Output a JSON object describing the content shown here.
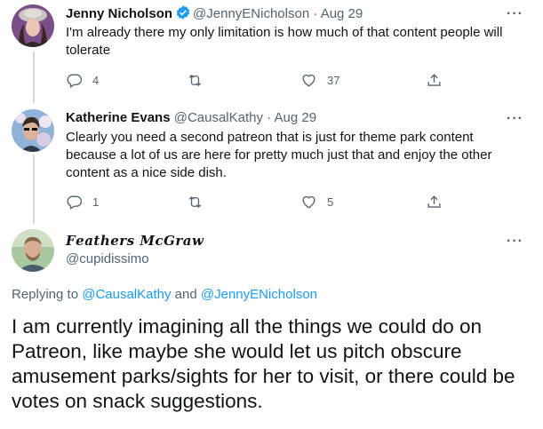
{
  "tweets": [
    {
      "name": "Jenny Nicholson",
      "handle": "@JennyENicholson",
      "dot": "·",
      "date": "Aug 29",
      "more": "···",
      "text": "I'm already there my only limitation is how much of that content people will tolerate",
      "replies": "4",
      "retweets": "",
      "likes": "37",
      "verified": true
    },
    {
      "name": "Katherine Evans",
      "handle": "@CausalKathy",
      "dot": "·",
      "date": "Aug 29",
      "more": "···",
      "text": "Clearly you need a second patreon that is just for theme park content because a lot of us are here for pretty much just that and enjoy the other content as a nice side dish.",
      "replies": "1",
      "retweets": "",
      "likes": "5",
      "verified": false
    }
  ],
  "main": {
    "name": "𝑭𝒆𝒂𝒕𝒉𝒆𝒓𝒔 𝑴𝒄𝑮𝒓𝒂𝒘",
    "handle": "@cupidissimo",
    "more": "···",
    "replying_prefix": "Replying to ",
    "replying_to_1": "@CausalKathy",
    "replying_and": " and ",
    "replying_to_2": "@JennyENicholson",
    "text": "I am currently imagining all the things we could do on Patreon, like maybe she would let us pitch obscure amusement parks/sights for her to visit, or there could be votes on snack suggestions."
  },
  "icons": {
    "reply": "reply-icon",
    "retweet": "retweet-icon",
    "like": "heart-icon",
    "share": "share-icon",
    "verified": "verified-badge-icon"
  },
  "colors": {
    "accent": "#1d9bf0",
    "secondary_text": "#536471",
    "thread_line": "#cfd9de"
  }
}
